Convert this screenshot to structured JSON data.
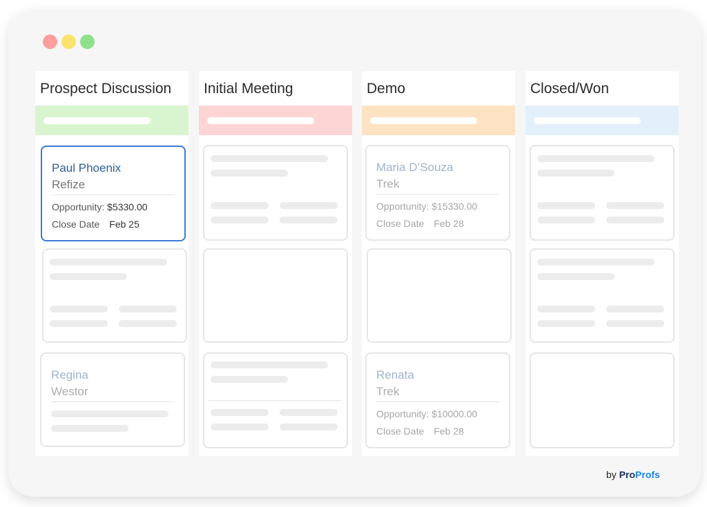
{
  "window": {
    "controls": [
      {
        "name": "close",
        "color": "#ff9e9e"
      },
      {
        "name": "minimize",
        "color": "#f9e36d"
      },
      {
        "name": "maximize",
        "color": "#8fe08a"
      }
    ]
  },
  "columns": [
    {
      "title": "Prospect Discussion",
      "band_color": "#d9f5d0",
      "cards": [
        {
          "name": "Paul Phoenix",
          "company": "Refize",
          "opportunity_label": "Opportunity:",
          "opportunity_value": "$5330.00",
          "close_label": "Close Date",
          "close_value": "Feb 25",
          "selected": true
        }
      ],
      "placeholder_cards": 1,
      "partial_cards": [
        {
          "name": "Regina",
          "company": "Westor"
        }
      ]
    },
    {
      "title": "Initial Meeting",
      "band_color": "#fdd5d5",
      "cards": [],
      "placeholder_cards": 3
    },
    {
      "title": "Demo",
      "band_color": "#fde3c3",
      "cards": [
        {
          "name": "Maria D’Souza",
          "company": "Trek",
          "opportunity_label": "Opportunity:",
          "opportunity_value": "$15330.00",
          "close_label": "Close Date",
          "close_value": "Feb 28",
          "selected": false
        },
        {
          "name": "Renata",
          "company": "Trek",
          "opportunity_label": "Opportunity:",
          "opportunity_value": "$10000.00",
          "close_label": "Close Date",
          "close_value": "Feb 28",
          "selected": false
        }
      ],
      "placeholder_cards": 1
    },
    {
      "title": "Closed/Won",
      "band_color": "#e3f0fc",
      "cards": [],
      "placeholder_cards": 3
    }
  ],
  "branding": {
    "by": "by",
    "pro": "Pro",
    "profs": "Profs"
  }
}
